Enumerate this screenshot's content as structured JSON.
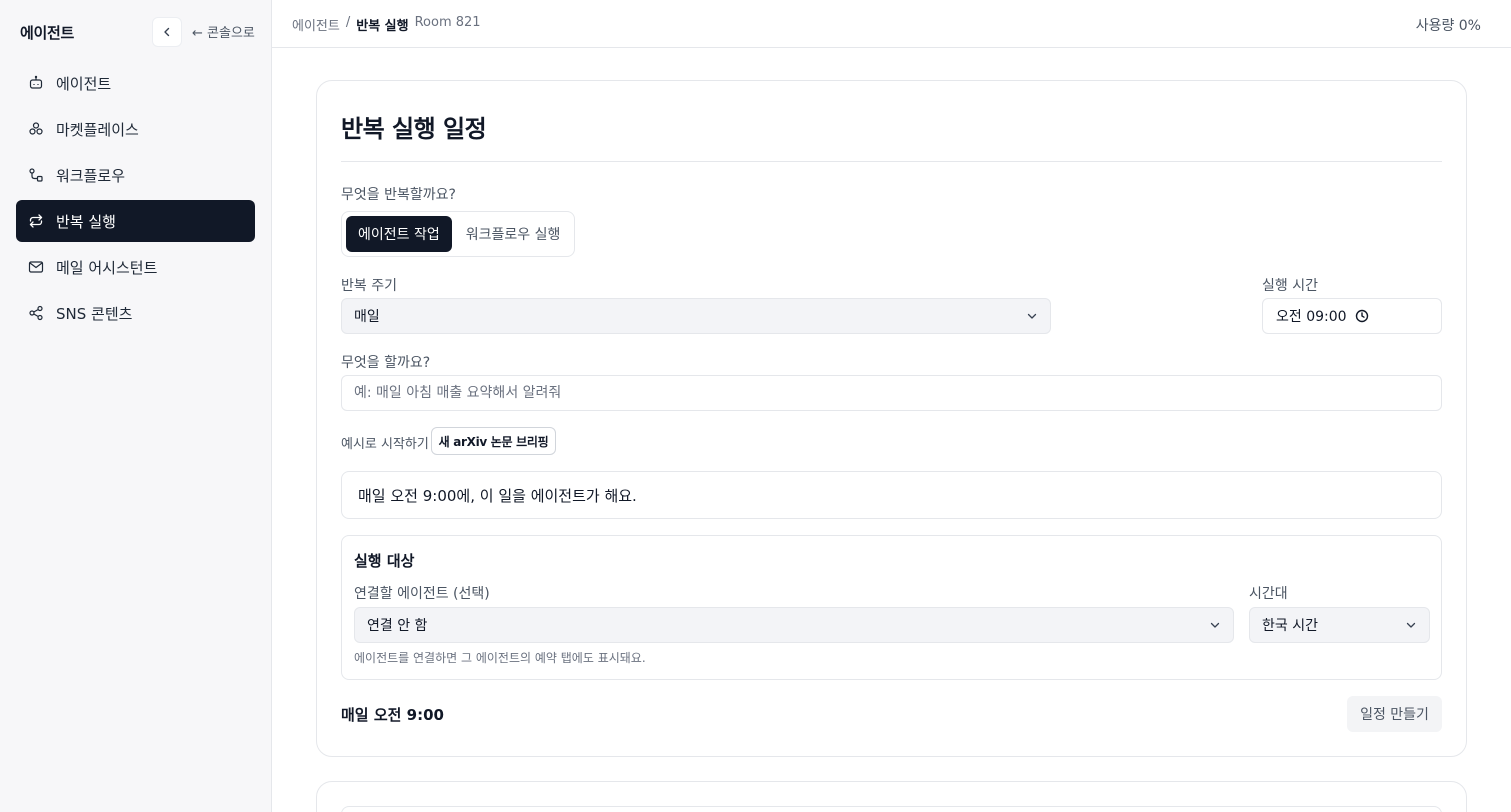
{
  "sidebar": {
    "title": "에이전트",
    "back_label": "← 콘솔으로",
    "items": [
      {
        "label": "에이전트",
        "icon": "bot-icon"
      },
      {
        "label": "마켓플레이스",
        "icon": "marketplace-icon"
      },
      {
        "label": "워크플로우",
        "icon": "workflow-icon"
      },
      {
        "label": "반복 실행",
        "icon": "repeat-icon",
        "active": true
      },
      {
        "label": "메일 어시스턴트",
        "icon": "mail-icon"
      },
      {
        "label": "SNS 콘텐츠",
        "icon": "share-icon"
      }
    ]
  },
  "topbar": {
    "breadcrumb": [
      "에이전트",
      "/",
      "반복 실행",
      "Room 821"
    ],
    "usage": "사용량 0%"
  },
  "form": {
    "title": "반복 실행 일정",
    "what_repeat_label": "무엇을 반복할까요?",
    "segments": [
      "에이전트 작업",
      "워크플로우 실행"
    ],
    "frequency_label": "반복 주기",
    "frequency_value": "매일",
    "time_label": "실행 시간",
    "time_value": "오전 09:00",
    "task_label": "무엇을 할까요?",
    "task_placeholder": "예: 매일 아침 매출 요약해서 알려줘",
    "example_label": "예시로 시작하기",
    "example_button": "새 arXiv 논문 브리핑",
    "summary": "매일 오전 9:00에, 이 일을 에이전트가 해요.",
    "target": {
      "title": "실행 대상",
      "agent_label": "연결할 에이전트 (선택)",
      "agent_value": "연결 안 함",
      "tz_label": "시간대",
      "tz_value": "한국 시간",
      "help": "에이전트를 연결하면 그 에이전트의 예약 탭에도 표시돼요."
    },
    "footer_summary": "매일 오전 9:00",
    "create_button": "일정 만들기"
  },
  "colors": {
    "active_bg": "#111827",
    "sidebar_bg": "#f7f7f9",
    "border": "#e5e7eb"
  }
}
